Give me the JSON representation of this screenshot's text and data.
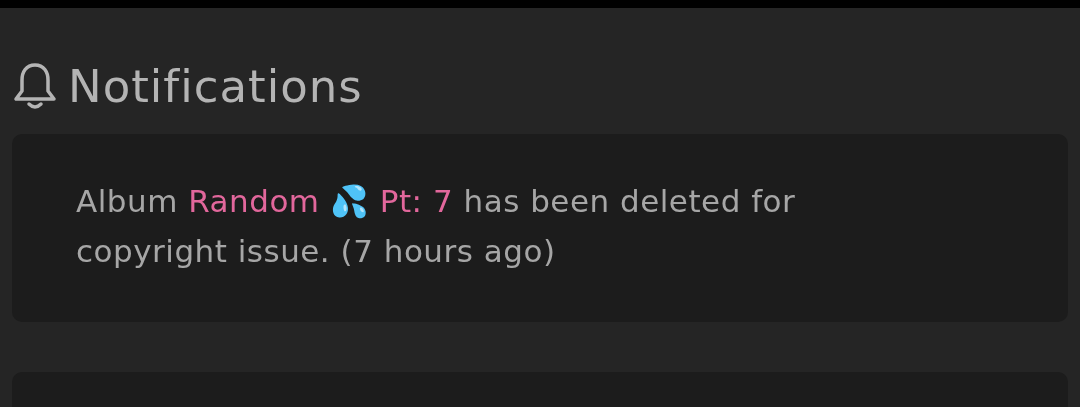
{
  "title": "Notifications",
  "notifications": [
    {
      "text_before": "Album ",
      "link": "Random 💦 Pt: 7",
      "text_after": " has been deleted for copyright issue. (7 hours ago)"
    }
  ]
}
